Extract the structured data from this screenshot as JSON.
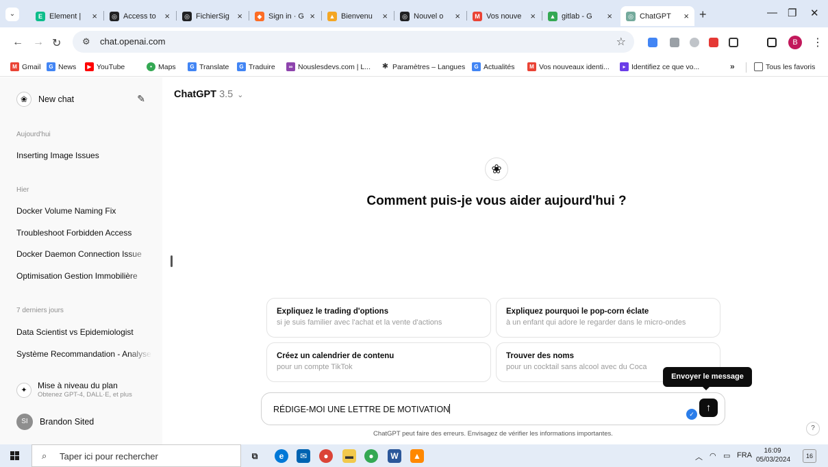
{
  "browser": {
    "tabs": [
      {
        "label": "Element |",
        "icon": "element-icon",
        "color": "#0dbd8b"
      },
      {
        "label": "Access to",
        "icon": "openai-icon",
        "color": "#202123"
      },
      {
        "label": "FichierSig",
        "icon": "openai-icon",
        "color": "#202123"
      },
      {
        "label": "Sign in · G",
        "icon": "gitlab-icon",
        "color": "#fc6d26"
      },
      {
        "label": "Bienvenu",
        "icon": "fire-icon",
        "color": "#f4a623"
      },
      {
        "label": "Nouvel o",
        "icon": "openai-icon",
        "color": "#202123"
      },
      {
        "label": "Vos nouve",
        "icon": "gmail-icon",
        "color": "#ea4335"
      },
      {
        "label": "gitlab - G",
        "icon": "drive-icon",
        "color": "#34a853"
      },
      {
        "label": "ChatGPT",
        "icon": "chatgpt-icon",
        "color": "#74aa9c"
      }
    ],
    "url": "chat.openai.com",
    "profile_initial": "B",
    "bookmarks": [
      {
        "label": "Gmail",
        "icon": "gmail-icon",
        "color": "#ea4335"
      },
      {
        "label": "News",
        "icon": "news-icon",
        "color": "#4285f4"
      },
      {
        "label": "YouTube",
        "icon": "youtube-icon",
        "color": "#ff0000"
      },
      {
        "label": "Maps",
        "icon": "maps-icon",
        "color": "#34a853"
      },
      {
        "label": "Translate",
        "icon": "translate-icon",
        "color": "#4285f4"
      },
      {
        "label": "Traduire",
        "icon": "translate-icon",
        "color": "#4285f4"
      },
      {
        "label": "Nouslesdevs.com | L...",
        "icon": "site-icon",
        "color": "#8e44ad"
      },
      {
        "label": "Paramètres – Langues",
        "icon": "gear-icon",
        "color": "#333333"
      },
      {
        "label": "Actualités",
        "icon": "news-icon",
        "color": "#4285f4"
      },
      {
        "label": "Vos nouveaux identi...",
        "icon": "gmail-icon",
        "color": "#ea4335"
      },
      {
        "label": "Identifiez ce que vo...",
        "icon": "site-icon",
        "color": "#6a3de8"
      }
    ],
    "all_bookmarks": "Tous les favoris"
  },
  "sidebar": {
    "new_chat": "New chat",
    "sections": [
      {
        "label": "Aujourd'hui",
        "items": [
          "Inserting Image Issues"
        ]
      },
      {
        "label": "Hier",
        "items": [
          "Docker Volume Naming Fix",
          "Troubleshoot Forbidden Access",
          "Docker Daemon Connection Issue",
          "Optimisation Gestion Immobilière"
        ]
      },
      {
        "label": "7 derniers jours",
        "items": [
          "Data Scientist vs Epidemiologist",
          "Système Recommandation - Analyse"
        ]
      }
    ],
    "upgrade_title": "Mise à niveau du plan",
    "upgrade_sub": "Obtenez GPT-4, DALL·E, et plus",
    "user_initials": "SI",
    "user_name": "Brandon Sited"
  },
  "main": {
    "model_name": "ChatGPT",
    "model_version": "3.5",
    "heading": "Comment puis-je vous aider aujourd'hui ?",
    "suggestions": [
      {
        "title": "Expliquez le trading d'options",
        "subtitle": "si je suis familier avec l'achat et la vente d'actions"
      },
      {
        "title": "Expliquez pourquoi le pop-corn éclate",
        "subtitle": "à un enfant qui adore le regarder dans le micro-ondes"
      },
      {
        "title": "Créez un calendrier de contenu",
        "subtitle": "pour un compte TikTok"
      },
      {
        "title": "Trouver des noms",
        "subtitle": "pour un cocktail sans alcool avec du Coca"
      }
    ],
    "input_value": "RÉDIGE-MOI UNE LETTRE DE MOTIVATION",
    "send_tooltip": "Envoyer le message",
    "disclaimer": "ChatGPT peut faire des erreurs. Envisagez de vérifier les informations importantes.",
    "help": "?"
  },
  "taskbar": {
    "search_placeholder": "Taper ici pour rechercher",
    "language": "FRA",
    "time": "16:09",
    "date": "05/03/2024",
    "notifications": "16"
  }
}
